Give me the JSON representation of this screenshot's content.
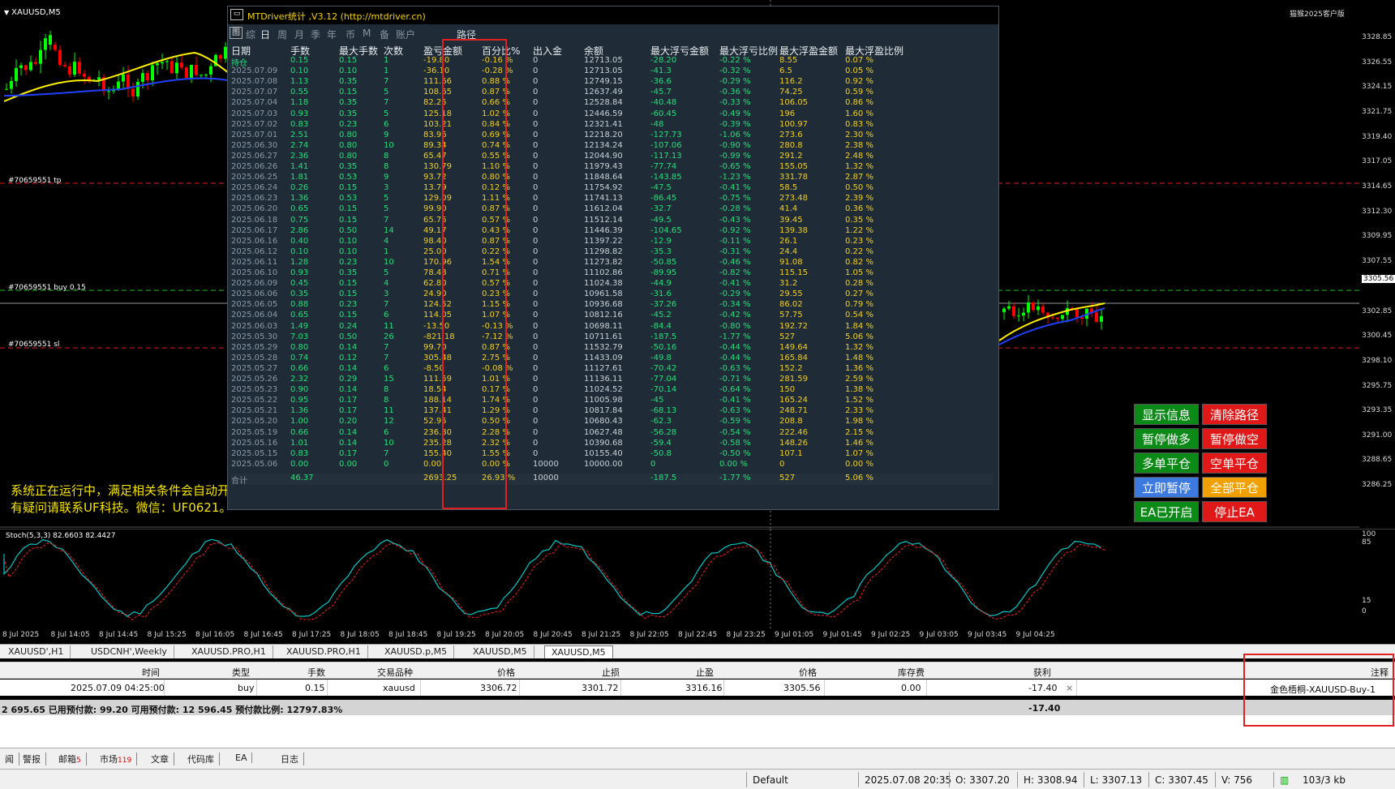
{
  "chart": {
    "symbol": "XAUUSD,M5",
    "watermark": "猫猴2025客户版",
    "orders": [
      {
        "label": "#70659551 tp",
        "line": "tp"
      },
      {
        "label": "#70659551 buy 0.15",
        "line": "buy"
      },
      {
        "label": "#70659551 sl",
        "line": "sl"
      }
    ],
    "system_messages": [
      "系统正在运行中，满足相关条件会自动开",
      "有疑问请联系UF科技。微信：UF0621。"
    ],
    "price_labels": [
      "3328.85",
      "3326.55",
      "3324.15",
      "3321.75",
      "3319.40",
      "3317.05",
      "3314.65",
      "3312.30",
      "3309.95",
      "3307.55",
      "3305.56",
      "3302.85",
      "3300.45",
      "3298.10",
      "3295.75",
      "3293.35",
      "3291.00",
      "3288.65",
      "3286.25"
    ],
    "current_price": "3305.56",
    "stoch_label": "Stoch(5,3,3) 82.6603 82.4427",
    "stoch_levels": [
      "100",
      "85",
      "15",
      "0"
    ],
    "time_labels": [
      "8 Jul 2025",
      "8 Jul 14:05",
      "8 Jul 14:45",
      "8 Jul 15:25",
      "8 Jul 16:05",
      "8 Jul 16:45",
      "8 Jul 17:25",
      "8 Jul 18:05",
      "8 Jul 18:45",
      "8 Jul 19:25",
      "8 Jul 20:05",
      "8 Jul 20:45",
      "8 Jul 21:25",
      "8 Jul 22:05",
      "8 Jul 22:45",
      "8 Jul 23:25",
      "9 Jul 01:05",
      "9 Jul 01:45",
      "9 Jul 02:25",
      "9 Jul 03:05",
      "9 Jul 03:45",
      "9 Jul 04:25"
    ],
    "colors": {
      "up": "#00ff00",
      "down": "#ff0000",
      "ma_fast": "#ffee00",
      "ma_slow": "#2040ff",
      "stoch_main": "#00c8c8",
      "stoch_signal": "#ff2020"
    }
  },
  "stats": {
    "title": "MTDriver统计 ,V3.12 (http://mtdriver.cn)",
    "minimize": "▭",
    "tabs_icon": "图",
    "tabs": [
      "综",
      "日",
      "周",
      "月",
      "季",
      "年",
      "币",
      "M",
      "备",
      "账户"
    ],
    "path_label": "路径",
    "headers": [
      "日期",
      "手数",
      "最大手数",
      "次数",
      "盈亏金额",
      "百分比%",
      "出入金",
      "余额",
      "最大浮亏金额",
      "最大浮亏比例",
      "最大浮盈金额",
      "最大浮盈比例"
    ],
    "rows": [
      [
        "持仓",
        "0.15",
        "0.15",
        "1",
        "-19.80",
        "-0.16 %",
        "0",
        "12713.05",
        "-28.20",
        "-0.22 %",
        "8.55",
        "0.07 %"
      ],
      [
        "2025.07.09",
        "0.10",
        "0.10",
        "1",
        "-36.10",
        "-0.28 %",
        "0",
        "12713.05",
        "-41.3",
        "-0.32 %",
        "6.5",
        "0.05 %"
      ],
      [
        "2025.07.08",
        "1.13",
        "0.35",
        "7",
        "111.66",
        "0.88 %",
        "0",
        "12749.15",
        "-36.6",
        "-0.29 %",
        "116.2",
        "0.92 %"
      ],
      [
        "2025.07.07",
        "0.55",
        "0.15",
        "5",
        "108.65",
        "0.87 %",
        "0",
        "12637.49",
        "-45.7",
        "-0.36 %",
        "74.25",
        "0.59 %"
      ],
      [
        "2025.07.04",
        "1.18",
        "0.35",
        "7",
        "82.25",
        "0.66 %",
        "0",
        "12528.84",
        "-40.48",
        "-0.33 %",
        "106.05",
        "0.86 %"
      ],
      [
        "2025.07.03",
        "0.93",
        "0.35",
        "5",
        "125.18",
        "1.02 %",
        "0",
        "12446.59",
        "-60.45",
        "-0.49 %",
        "196",
        "1.60 %"
      ],
      [
        "2025.07.02",
        "0.83",
        "0.23",
        "6",
        "103.21",
        "0.84 %",
        "0",
        "12321.41",
        "-48",
        "-0.39 %",
        "100.97",
        "0.83 %"
      ],
      [
        "2025.07.01",
        "2.51",
        "0.80",
        "9",
        "83.96",
        "0.69 %",
        "0",
        "12218.20",
        "-127.73",
        "-1.06 %",
        "273.6",
        "2.30 %"
      ],
      [
        "2025.06.30",
        "2.74",
        "0.80",
        "10",
        "89.34",
        "0.74 %",
        "0",
        "12134.24",
        "-107.06",
        "-0.90 %",
        "280.8",
        "2.38 %"
      ],
      [
        "2025.06.27",
        "2.36",
        "0.80",
        "8",
        "65.47",
        "0.55 %",
        "0",
        "12044.90",
        "-117.13",
        "-0.99 %",
        "291.2",
        "2.48 %"
      ],
      [
        "2025.06.26",
        "1.41",
        "0.35",
        "8",
        "130.79",
        "1.10 %",
        "0",
        "11979.43",
        "-77.74",
        "-0.65 %",
        "155.05",
        "1.32 %"
      ],
      [
        "2025.06.25",
        "1.81",
        "0.53",
        "9",
        "93.72",
        "0.80 %",
        "0",
        "11848.64",
        "-143.85",
        "-1.23 %",
        "331.78",
        "2.87 %"
      ],
      [
        "2025.06.24",
        "0.26",
        "0.15",
        "3",
        "13.79",
        "0.12 %",
        "0",
        "11754.92",
        "-47.5",
        "-0.41 %",
        "58.5",
        "0.50 %"
      ],
      [
        "2025.06.23",
        "1.36",
        "0.53",
        "5",
        "129.09",
        "1.11 %",
        "0",
        "11741.13",
        "-86.45",
        "-0.75 %",
        "273.48",
        "2.39 %"
      ],
      [
        "2025.06.20",
        "0.65",
        "0.15",
        "5",
        "99.90",
        "0.87 %",
        "0",
        "11612.04",
        "-32.7",
        "-0.28 %",
        "41.4",
        "0.36 %"
      ],
      [
        "2025.06.18",
        "0.75",
        "0.15",
        "7",
        "65.75",
        "0.57 %",
        "0",
        "11512.14",
        "-49.5",
        "-0.43 %",
        "39.45",
        "0.35 %"
      ],
      [
        "2025.06.17",
        "2.86",
        "0.50",
        "14",
        "49.17",
        "0.43 %",
        "0",
        "11446.39",
        "-104.65",
        "-0.92 %",
        "139.38",
        "1.22 %"
      ],
      [
        "2025.06.16",
        "0.40",
        "0.10",
        "4",
        "98.40",
        "0.87 %",
        "0",
        "11397.22",
        "-12.9",
        "-0.11 %",
        "26.1",
        "0.23 %"
      ],
      [
        "2025.06.12",
        "0.10",
        "0.10",
        "1",
        "25.00",
        "0.22 %",
        "0",
        "11298.82",
        "-35.3",
        "-0.31 %",
        "24.4",
        "0.22 %"
      ],
      [
        "2025.06.11",
        "1.28",
        "0.23",
        "10",
        "170.96",
        "1.54 %",
        "0",
        "11273.82",
        "-50.85",
        "-0.46 %",
        "91.08",
        "0.82 %"
      ],
      [
        "2025.06.10",
        "0.93",
        "0.35",
        "5",
        "78.48",
        "0.71 %",
        "0",
        "11102.86",
        "-89.95",
        "-0.82 %",
        "115.15",
        "1.05 %"
      ],
      [
        "2025.06.09",
        "0.45",
        "0.15",
        "4",
        "62.80",
        "0.57 %",
        "0",
        "11024.38",
        "-44.9",
        "-0.41 %",
        "31.2",
        "0.28 %"
      ],
      [
        "2025.06.06",
        "0.35",
        "0.15",
        "3",
        "24.90",
        "0.23 %",
        "0",
        "10961.58",
        "-31.6",
        "-0.29 %",
        "29.55",
        "0.27 %"
      ],
      [
        "2025.06.05",
        "0.88",
        "0.23",
        "7",
        "124.52",
        "1.15 %",
        "0",
        "10936.68",
        "-37.26",
        "-0.34 %",
        "86.02",
        "0.79 %"
      ],
      [
        "2025.06.04",
        "0.65",
        "0.15",
        "6",
        "114.05",
        "1.07 %",
        "0",
        "10812.16",
        "-45.2",
        "-0.42 %",
        "57.75",
        "0.54 %"
      ],
      [
        "2025.06.03",
        "1.49",
        "0.24",
        "11",
        "-13.50",
        "-0.13 %",
        "0",
        "10698.11",
        "-84.4",
        "-0.80 %",
        "192.72",
        "1.84 %"
      ],
      [
        "2025.05.30",
        "7.03",
        "0.50",
        "26",
        "-821.18",
        "-7.12 %",
        "0",
        "10711.61",
        "-187.5",
        "-1.77 %",
        "527",
        "5.06 %"
      ],
      [
        "2025.05.29",
        "0.80",
        "0.14",
        "7",
        "99.70",
        "0.87 %",
        "0",
        "11532.79",
        "-50.16",
        "-0.44 %",
        "149.64",
        "1.32 %"
      ],
      [
        "2025.05.28",
        "0.74",
        "0.12",
        "7",
        "305.48",
        "2.75 %",
        "0",
        "11433.09",
        "-49.8",
        "-0.44 %",
        "165.84",
        "1.48 %"
      ],
      [
        "2025.05.27",
        "0.66",
        "0.14",
        "6",
        "-8.50",
        "-0.08 %",
        "0",
        "11127.61",
        "-70.42",
        "-0.63 %",
        "152.2",
        "1.36 %"
      ],
      [
        "2025.05.26",
        "2.32",
        "0.29",
        "15",
        "111.59",
        "1.01 %",
        "0",
        "11136.11",
        "-77.04",
        "-0.71 %",
        "281.59",
        "2.59 %"
      ],
      [
        "2025.05.23",
        "0.90",
        "0.14",
        "8",
        "18.54",
        "0.17 %",
        "0",
        "11024.52",
        "-70.14",
        "-0.64 %",
        "150",
        "1.38 %"
      ],
      [
        "2025.05.22",
        "0.95",
        "0.17",
        "8",
        "188.14",
        "1.74 %",
        "0",
        "11005.98",
        "-45",
        "-0.41 %",
        "165.24",
        "1.52 %"
      ],
      [
        "2025.05.21",
        "1.36",
        "0.17",
        "11",
        "137.41",
        "1.29 %",
        "0",
        "10817.84",
        "-68.13",
        "-0.63 %",
        "248.71",
        "2.33 %"
      ],
      [
        "2025.05.20",
        "1.00",
        "0.20",
        "12",
        "52.95",
        "0.50 %",
        "0",
        "10680.43",
        "-62.3",
        "-0.59 %",
        "208.8",
        "1.98 %"
      ],
      [
        "2025.05.19",
        "0.66",
        "0.14",
        "6",
        "236.80",
        "2.28 %",
        "0",
        "10627.48",
        "-56.28",
        "-0.54 %",
        "222.46",
        "2.15 %"
      ],
      [
        "2025.05.16",
        "1.01",
        "0.14",
        "10",
        "235.28",
        "2.32 %",
        "0",
        "10390.68",
        "-59.4",
        "-0.58 %",
        "148.26",
        "1.46 %"
      ],
      [
        "2025.05.15",
        "0.83",
        "0.17",
        "7",
        "155.40",
        "1.55 %",
        "0",
        "10155.40",
        "-50.8",
        "-0.50 %",
        "107.1",
        "1.07 %"
      ],
      [
        "2025.05.06",
        "0.00",
        "0.00",
        "0",
        "0.00",
        "0.00 %",
        "10000",
        "10000.00",
        "0",
        "0.00 %",
        "0",
        "0.00 %"
      ]
    ],
    "total": [
      "合计",
      "46.37",
      "",
      "",
      "2693.25",
      "26.93 %",
      "10000",
      "",
      "-187.5",
      "-1.77 %",
      "527",
      "5.06 %"
    ]
  },
  "ea_buttons": [
    {
      "label": "显示信息",
      "color": "green"
    },
    {
      "label": "清除路径",
      "color": "red"
    },
    {
      "label": "暂停做多",
      "color": "green"
    },
    {
      "label": "暂停做空",
      "color": "red"
    },
    {
      "label": "多单平仓",
      "color": "green"
    },
    {
      "label": "空单平仓",
      "color": "red"
    },
    {
      "label": "立即暂停",
      "color": "blue"
    },
    {
      "label": "全部平仓",
      "color": "orange"
    },
    {
      "label": "EA已开启",
      "color": "green"
    },
    {
      "label": "停止EA",
      "color": "red"
    }
  ],
  "symbol_tabs": [
    "XAUUSD',H1",
    "USDCNH',Weekly",
    "XAUUSD.PRO,H1",
    "XAUUSD.PRO,H1",
    "XAUUSD.p,M5",
    "XAUUSD,M5",
    "XAUUSD,M5"
  ],
  "trade": {
    "headers": [
      "时间",
      "类型",
      "手数",
      "交易品种",
      "价格",
      "止损",
      "止盈",
      "价格",
      "库存费",
      "获利",
      "注释"
    ],
    "row": [
      "2025.07.09 04:25:00",
      "buy",
      "0.15",
      "xauusd",
      "3306.72",
      "3301.72",
      "3316.16",
      "3305.56",
      "0.00",
      "-17.40",
      "金色梧桐-XAUUSD-Buy-1"
    ],
    "close_icon": "×",
    "balance_text": "2 695.65   已用预付款: 99.20   可用预付款: 12 596.45   预付款比例: 12797.83%",
    "balance_profit": "-17.40"
  },
  "terminal_tabs": [
    {
      "label": "闻"
    },
    {
      "label": "警报"
    },
    {
      "label": "邮箱",
      "count": "5"
    },
    {
      "label": "市场",
      "count": "119"
    },
    {
      "label": "文章"
    },
    {
      "label": "代码库"
    },
    {
      "label": "EA"
    },
    {
      "label": "日志"
    }
  ],
  "status": {
    "profile": "Default",
    "datetime": "2025.07.08 20:35",
    "open": "O: 3307.20",
    "high": "H: 3308.94",
    "low": "L: 3307.13",
    "close": "C: 3307.45",
    "volume": "V: 756",
    "traffic": "103/3 kb"
  }
}
